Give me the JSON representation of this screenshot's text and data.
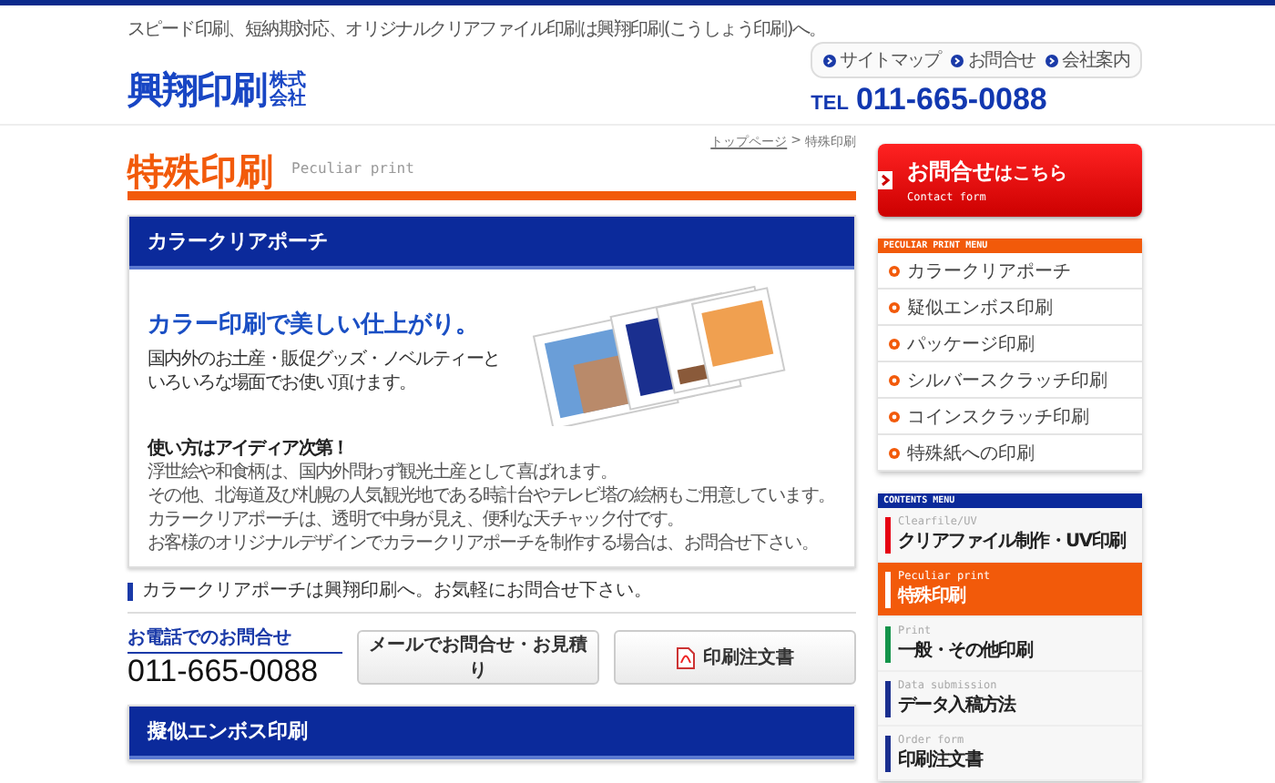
{
  "header": {
    "tagline": "スピード印刷、短納期対応、オリジナルクリアファイル印刷は興翔印刷(こうしょう印刷)へ。",
    "logo": "興翔印刷",
    "logo_suffix": "株式会社",
    "links": [
      "サイトマップ",
      "お問合せ",
      "会社案内"
    ],
    "tel_label": "TEL",
    "tel": "011-665-0088"
  },
  "page_title": {
    "title": "特殊印刷",
    "subtitle": "Peculiar print"
  },
  "breadcrumb": {
    "home": "トップページ",
    "separator": ">",
    "current": "特殊印刷"
  },
  "sections": [
    {
      "title": "カラークリアポーチ",
      "headline": "カラー印刷で美しい仕上がり。",
      "lead_lines": [
        "国内外のお土産・販促グッズ・ノベルティーと",
        "いろいろな場面でお使い頂けます。"
      ],
      "body_heading": "使い方はアイディア次第！",
      "body_lines": [
        "浮世絵や和食柄は、国内外問わず観光土産として喜ばれます。",
        "その他、北海道及び札幌の人気観光地である時計台やテレビ塔の絵柄もご用意しています。",
        "カラークリアポーチは、透明で中身が見え、便利な天チャック付です。",
        "お客様のオリジナルデザインでカラークリアポーチを制作する場合は、お問合せ下さい。"
      ]
    },
    {
      "title": "擬似エンボス印刷"
    }
  ],
  "note": "カラークリアポーチは興翔印刷へ。お気軽にお問合せ下さい。",
  "phone": {
    "label": "お電話でのお問合せ",
    "number": "011-665-0088"
  },
  "buttons": [
    {
      "label": "メールでお問合せ・お見積り",
      "kind": "mail"
    },
    {
      "label": "印刷注文書",
      "kind": "pdf"
    }
  ],
  "sidebar": {
    "contact": {
      "title": "お問合せ",
      "suffix": "はこちら",
      "subtitle": "Contact form"
    },
    "peculiar_menu": {
      "heading": "PECULIAR PRINT MENU",
      "items": [
        "カラークリアポーチ",
        "疑似エンボス印刷",
        "パッケージ印刷",
        "シルバースクラッチ印刷",
        "コインスクラッチ印刷",
        "特殊紙への印刷"
      ]
    },
    "contents_menu": {
      "heading": "CONTENTS MENU",
      "items": [
        {
          "en": "Clearfile/UV",
          "label": "クリアファイル制作・UV印刷",
          "color": "#e60012",
          "selected": false
        },
        {
          "en": "Peculiar print",
          "label": "特殊印刷",
          "color": "#ffffff",
          "selected": true
        },
        {
          "en": "Print",
          "label": "一般・その他印刷",
          "color": "#13934a",
          "selected": false
        },
        {
          "en": "Data submission",
          "label": "データ入稿方法",
          "color": "#1a2f8f",
          "selected": false
        },
        {
          "en": "Order form",
          "label": "印刷注文書",
          "color": "#1a2f8f",
          "selected": false
        }
      ]
    }
  }
}
